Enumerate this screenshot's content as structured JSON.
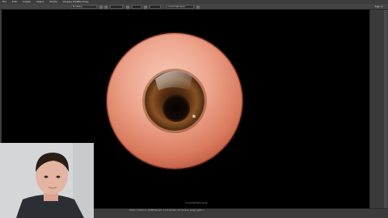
{
  "menu": {
    "items": [
      "File",
      "Edit",
      "Create",
      "Select",
      "Modify",
      "Display",
      "Windows"
    ],
    "help_label": "Help"
  },
  "toolbar": {
    "mode_dropdown": "Modeling",
    "workspace_label": "Workspace:",
    "renderer_label": "Arnold Renderer",
    "right_label": "Sign In"
  },
  "viewport": {
    "hud_line_1": "Arnold Renderer",
    "hud_line_2": "persp"
  },
  "statusbar": {
    "stats_line": "Frame: 1   Memory: 316MB   Render: 0.34s   Sample: 3/3   Camera: persp   Lights: 1"
  },
  "colors": {
    "viewport_bg": "#000000",
    "panel_bg": "#3d3d3d",
    "sclera": "#e8a48f",
    "iris": "#6b3b17"
  },
  "icons": {
    "webcam": "person-webcam-overlay"
  }
}
